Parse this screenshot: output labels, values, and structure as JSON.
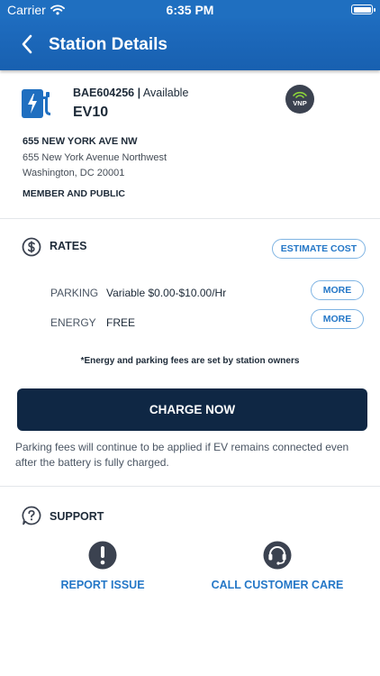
{
  "status_bar": {
    "carrier": "Carrier",
    "time": "6:35 PM"
  },
  "nav": {
    "title": "Station Details"
  },
  "station": {
    "id": "BAE604256",
    "separator": "|",
    "status": "Available",
    "name": "EV10",
    "badge": "VNP",
    "address_line1": "655 NEW YORK AVE NW",
    "address_line2": "655 New York Avenue Northwest",
    "address_line3": "Washington, DC 20001",
    "access": "MEMBER AND PUBLIC"
  },
  "rates": {
    "heading": "RATES",
    "estimate_label": "ESTIMATE COST",
    "rows": [
      {
        "label": "PARKING",
        "value": "Variable $0.00-$10.00/Hr",
        "more_label": "MORE"
      },
      {
        "label": "ENERGY",
        "value": "FREE",
        "more_label": "MORE"
      }
    ],
    "note": "*Energy and parking fees are set by station owners",
    "charge_label": "CHARGE NOW",
    "disclaimer": "Parking fees will continue to be applied if EV remains connected even after the battery is fully charged."
  },
  "support": {
    "heading": "SUPPORT",
    "report_label": "REPORT ISSUE",
    "care_label": "CALL CUSTOMER CARE"
  },
  "colors": {
    "primary": "#1f6fc0",
    "dark_button": "#0f2744",
    "link": "#2477c7"
  },
  "icons": [
    "wifi-icon",
    "battery-icon",
    "back-chevron-icon",
    "ev-charger-icon",
    "vnp-wifi-icon",
    "dollar-icon",
    "question-icon",
    "alert-icon",
    "headset-icon"
  ]
}
